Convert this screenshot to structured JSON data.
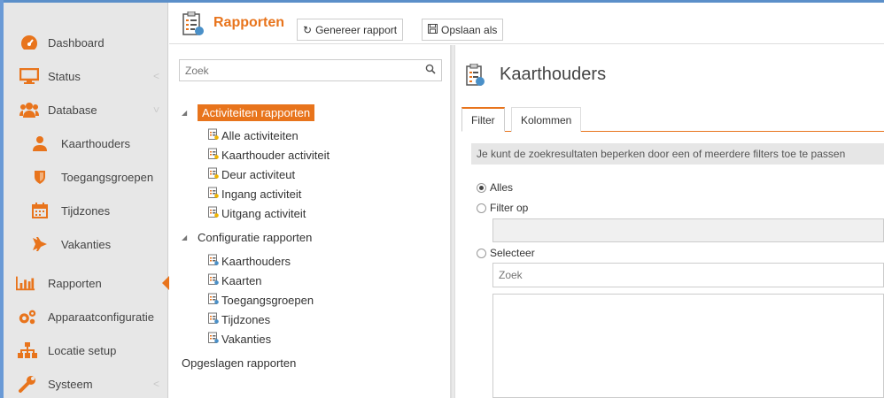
{
  "sidebar": {
    "items": [
      {
        "label": "Dashboard",
        "icon": "dashboard-icon"
      },
      {
        "label": "Status",
        "icon": "monitor-icon"
      },
      {
        "label": "Database",
        "icon": "users-icon"
      },
      {
        "label": "Kaarthouders",
        "icon": "user-icon"
      },
      {
        "label": "Toegangsgroepen",
        "icon": "shield-icon"
      },
      {
        "label": "Tijdzones",
        "icon": "calendar-icon"
      },
      {
        "label": "Vakanties",
        "icon": "plane-icon"
      },
      {
        "label": "Rapporten",
        "icon": "bar-chart-icon"
      },
      {
        "label": "Apparaatconfiguratie",
        "icon": "cogs-icon"
      },
      {
        "label": "Locatie setup",
        "icon": "sitemap-icon"
      },
      {
        "label": "Systeem",
        "icon": "wrench-icon"
      }
    ],
    "chevron": "<"
  },
  "toolbar": {
    "title": "Rapporten",
    "generate_label": "Genereer rapport",
    "save_as_label": "Opslaan als"
  },
  "tree": {
    "search_placeholder": "Zoek",
    "groups": [
      {
        "label": "Activiteiten rapporten",
        "items": [
          "Alle activiteiten",
          "Kaarthouder activiteit",
          "Deur activiteut",
          "Ingang activiteit",
          "Uitgang activiteit"
        ]
      },
      {
        "label": "Configuratie rapporten",
        "items": [
          "Kaarthouders",
          "Kaarten",
          "Toegangsgroepen",
          "Tijdzones",
          "Vakanties"
        ]
      },
      {
        "label": "Opgeslagen rapporten",
        "items": []
      }
    ]
  },
  "report": {
    "title": "Kaarthouders",
    "tabs": [
      "Filter",
      "Kolommen"
    ],
    "hint": "Je kunt de zoekresultaten beperken door een of meerdere filters toe te passen",
    "options": [
      "Alles",
      "Filter op",
      "Selecteer"
    ],
    "zoek_placeholder": "Zoek"
  },
  "colors": {
    "accent": "#e8741c",
    "sidebar_bg": "#e7e7e7"
  }
}
